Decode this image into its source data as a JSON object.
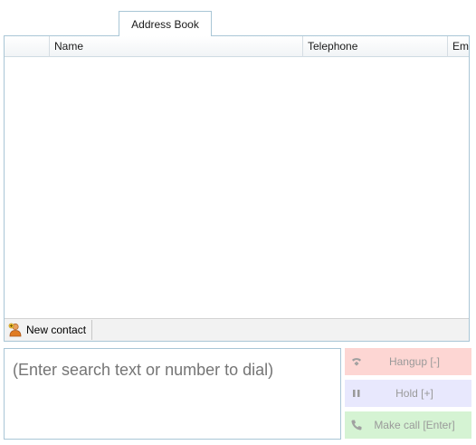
{
  "tabs": [
    {
      "label": "Address Book"
    }
  ],
  "grid": {
    "columns": [
      "",
      "Name",
      "Telephone",
      "Em"
    ],
    "rows": []
  },
  "toolbar": {
    "new_contact_label": "New contact"
  },
  "search": {
    "placeholder": "(Enter search text or number to dial)",
    "value": ""
  },
  "call_buttons": {
    "hangup_label": "Hangup [-]",
    "hold_label": "Hold [+]",
    "make_call_label": "Make call [Enter]"
  },
  "colors": {
    "border": "#a9c6d6",
    "hangup_bg": "#fdd6d3",
    "hold_bg": "#e8e8fd",
    "call_bg": "#d5f3d3",
    "disabled_text": "#9a9a9a"
  },
  "icons": {
    "new_contact": "person-add-icon",
    "hangup": "hangup-phone-icon",
    "hold": "pause-icon",
    "make_call": "phone-icon"
  }
}
